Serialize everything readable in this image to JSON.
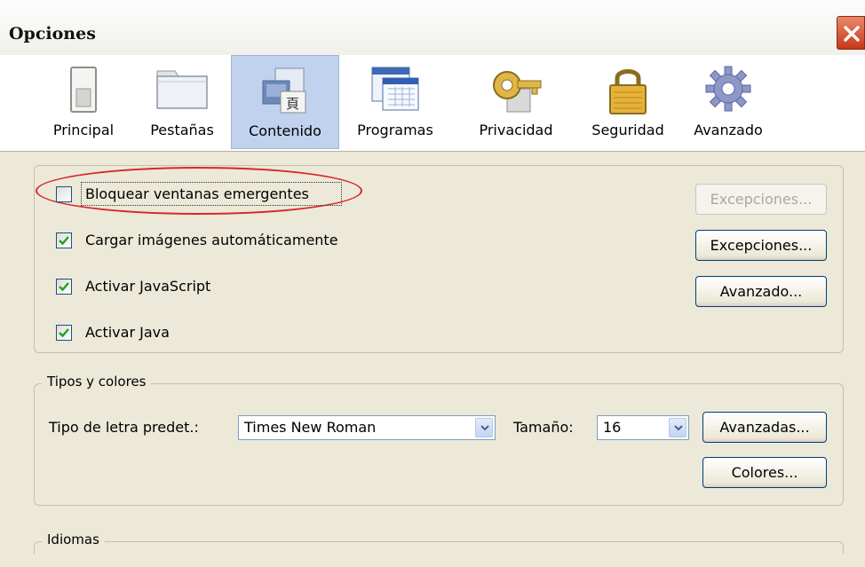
{
  "window": {
    "title": "Opciones"
  },
  "toolbar": {
    "items": [
      {
        "label": "Principal",
        "icon": "switch-icon"
      },
      {
        "label": "Pestañas",
        "icon": "folder-tabs-icon"
      },
      {
        "label": "Contenido",
        "icon": "content-icon",
        "selected": true
      },
      {
        "label": "Programas",
        "icon": "programs-window-icon"
      },
      {
        "label": "Privacidad",
        "icon": "mask-key-icon"
      },
      {
        "label": "Seguridad",
        "icon": "padlock-icon"
      },
      {
        "label": "Avanzado",
        "icon": "gear-icon"
      }
    ]
  },
  "content": {
    "block_popups": {
      "label": "Bloquear ventanas emergentes",
      "checked": false
    },
    "load_images": {
      "label": "Cargar imágenes automáticamente",
      "checked": true
    },
    "enable_js": {
      "label": "Activar JavaScript",
      "checked": true
    },
    "enable_java": {
      "label": "Activar Java",
      "checked": true
    },
    "exceptions_popup": "Excepciones...",
    "exceptions_images": "Excepciones...",
    "advanced_js": "Avanzado..."
  },
  "fonts": {
    "legend": "Tipos y colores",
    "default_font_label": "Tipo de letra predet.:",
    "default_font_value": "Times New Roman",
    "size_label": "Tamaño:",
    "size_value": "16",
    "advanced_button": "Avanzadas...",
    "colors_button": "Colores..."
  },
  "languages": {
    "legend": "Idiomas"
  },
  "colors": {
    "selected_tab": "#c1d2ee",
    "highlight_circle": "#d8262d",
    "check": "#21a121"
  }
}
